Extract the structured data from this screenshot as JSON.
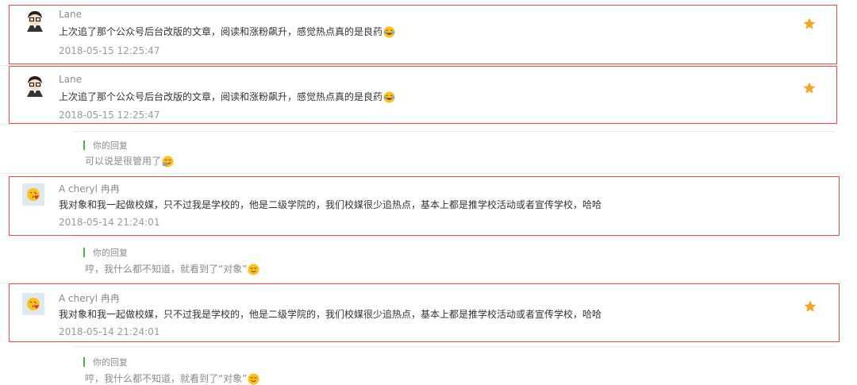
{
  "comments": [
    {
      "name": "Lane",
      "content": "上次追了那个公众号后台改版的文章，阅读和涨粉飙升，感觉热点真的是良药",
      "time": "2018-05-15 12:25:47",
      "avatar": "cartoon-boy-avatar",
      "emoji": "laughing-tears-emoji",
      "star": "star-icon"
    },
    {
      "name": "Lane",
      "content": "上次追了那个公众号后台改版的文章，阅读和涨粉飙升，感觉热点真的是良药",
      "time": "2018-05-15 12:25:47",
      "avatar": "cartoon-boy-avatar",
      "emoji": "laughing-tears-emoji",
      "star": "star-icon"
    },
    {
      "name": "A cheryl 冉冉",
      "content": "我对象和我一起做校媒，只不过我是学校的，他是二级学院的，我们校媒很少追热点，基本上都是推学校活动或者宣传学校，哈哈",
      "time": "2018-05-14 21:24:01",
      "avatar": "kiss-emoji-avatar"
    },
    {
      "name": "A cheryl 冉冉",
      "content": "我对象和我一起做校媒，只不过我是学校的，他是二级学院的，我们校媒很少追热点，基本上都是推学校活动或者宣传学校，哈哈",
      "time": "2018-05-14 21:24:01",
      "avatar": "kiss-emoji-avatar",
      "star": "star-icon"
    }
  ],
  "replies": [
    {
      "label": "你的回复",
      "text": "可以说是很管用了",
      "emoji": "smirk-emoji"
    },
    {
      "label": "你的回复",
      "text": "哼，我什么都不知道，就看到了“对象”",
      "emoji": "sly-emoji"
    },
    {
      "label": "你的回复",
      "text": "哼，我什么都不知道，就看到了“对象”",
      "emoji": "sly-emoji"
    }
  ],
  "colors": {
    "highlight": "#e54d4d",
    "star": "#f5a623",
    "reply_bar": "#44b549"
  }
}
